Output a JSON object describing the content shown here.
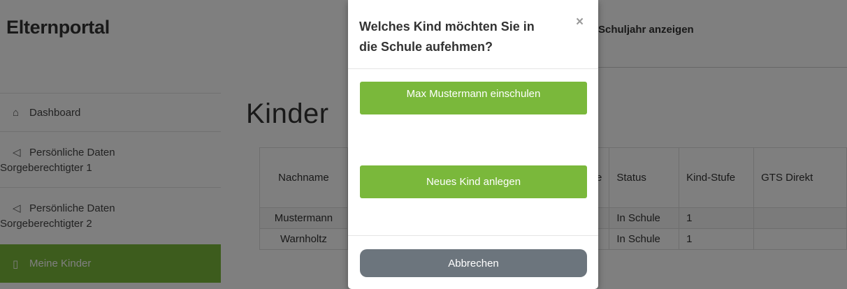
{
  "header": {
    "brand": "Elternportal",
    "school_year_link": "Schuljahr anzeigen"
  },
  "sidebar": {
    "items": [
      {
        "icon": "home-icon",
        "label": "Dashboard",
        "label2": ""
      },
      {
        "icon": "send-icon",
        "label": "Persönliche Daten",
        "label2": "Sorgeberechtigter 1"
      },
      {
        "icon": "send-icon",
        "label": "Persönliche Daten",
        "label2": "Sorgeberechtigter 2"
      },
      {
        "icon": "book-icon",
        "label": "Meine Kinder",
        "label2": "",
        "active": true
      }
    ]
  },
  "main": {
    "heading": "Kinder",
    "table": {
      "headers": [
        "Nachname",
        "asse",
        "Status",
        "Kind-Stufe",
        "GTS Direkt"
      ],
      "rows": [
        [
          "Mustermann",
          "",
          "In Schule",
          "1",
          ""
        ],
        [
          "Warnholtz",
          "",
          "In Schule",
          "1",
          ""
        ]
      ]
    }
  },
  "modal": {
    "title": "Welches Kind möchten Sie in die Schule aufehmen?",
    "close": "×",
    "child_button": "Max Mustermann einschulen",
    "new_button": "Neues Kind anlegen",
    "cancel_button": "Abbrechen"
  },
  "colors": {
    "accent_green": "#7ab83b",
    "cancel_gray": "#6c757d",
    "overlay": "rgba(0,0,0,0.5)"
  }
}
